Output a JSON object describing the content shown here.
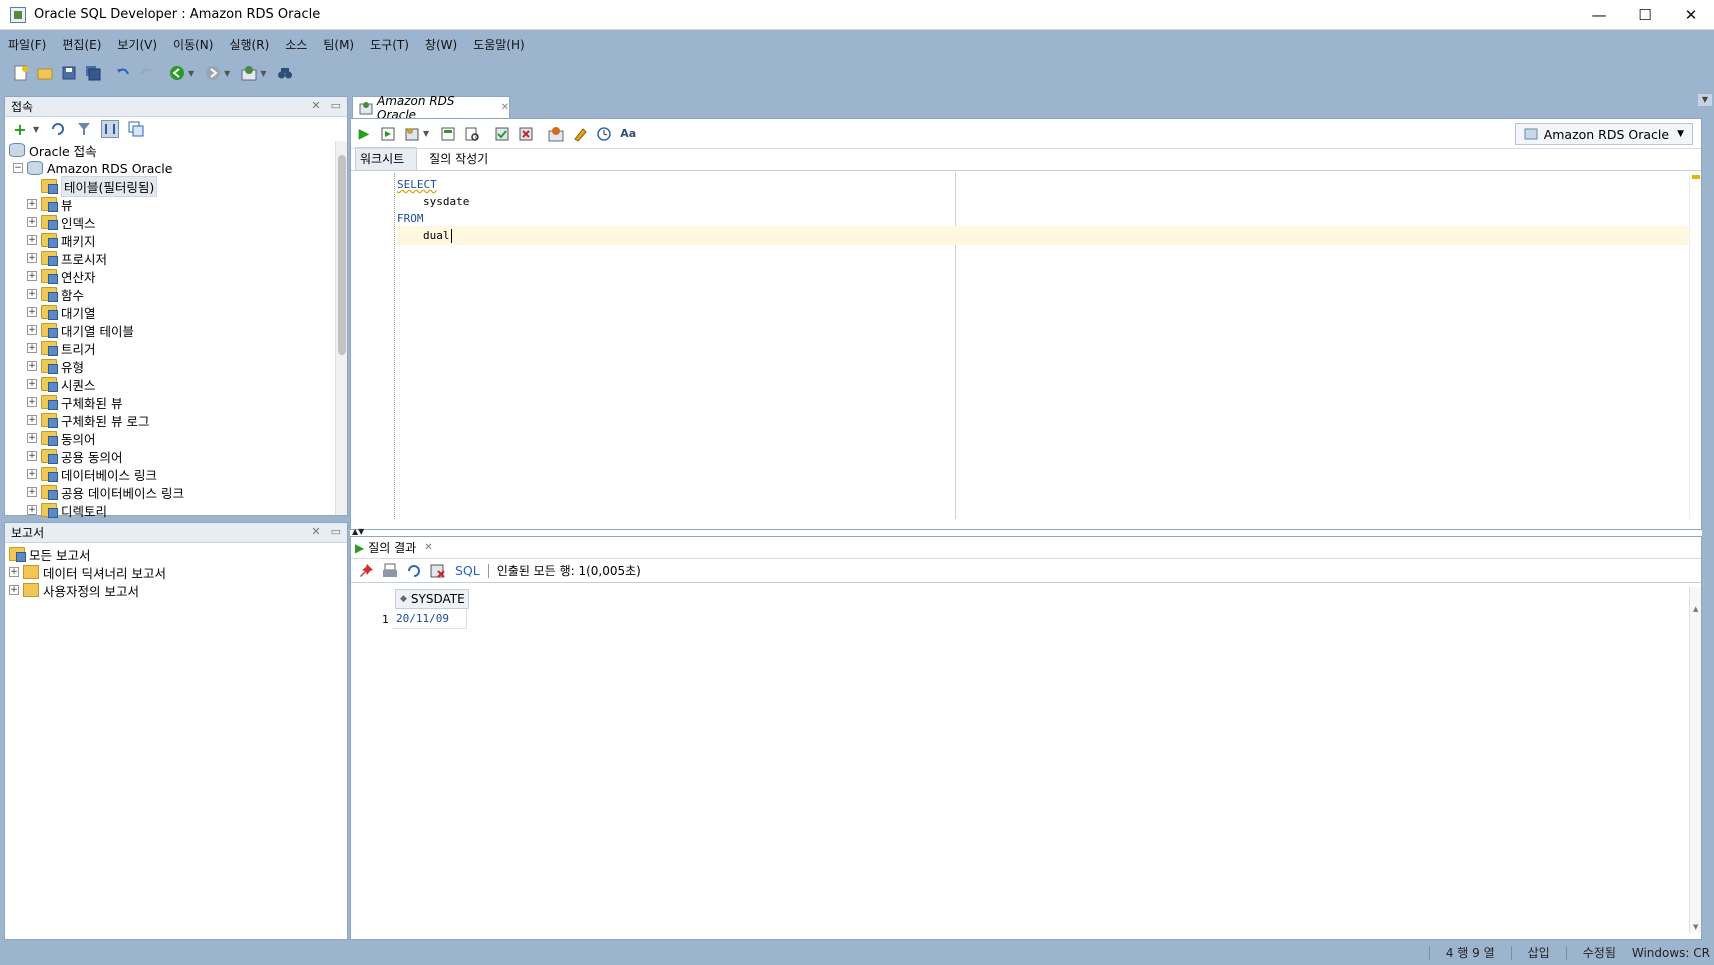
{
  "window": {
    "title": "Oracle SQL Developer : Amazon RDS Oracle",
    "minimize": "—",
    "maximize": "☐",
    "close": "✕"
  },
  "menu": [
    "파일(F)",
    "편집(E)",
    "보기(V)",
    "이동(N)",
    "실행(R)",
    "소스",
    "팀(M)",
    "도구(T)",
    "창(W)",
    "도움말(H)"
  ],
  "connections_panel": {
    "title": "접속",
    "tree": {
      "root": "Oracle 접속",
      "connection": "Amazon RDS Oracle",
      "items": [
        {
          "label": "테이블(필터링됨)",
          "expandable": false,
          "selected": true
        },
        {
          "label": "뷰",
          "expandable": true
        },
        {
          "label": "인덱스",
          "expandable": true
        },
        {
          "label": "패키지",
          "expandable": true
        },
        {
          "label": "프로시저",
          "expandable": true
        },
        {
          "label": "연산자",
          "expandable": true
        },
        {
          "label": "함수",
          "expandable": true
        },
        {
          "label": "대기열",
          "expandable": true
        },
        {
          "label": "대기열 테이블",
          "expandable": true
        },
        {
          "label": "트리거",
          "expandable": true
        },
        {
          "label": "유형",
          "expandable": true
        },
        {
          "label": "시퀀스",
          "expandable": true
        },
        {
          "label": "구체화된 뷰",
          "expandable": true
        },
        {
          "label": "구체화된 뷰 로그",
          "expandable": true
        },
        {
          "label": "동의어",
          "expandable": true
        },
        {
          "label": "공용 동의어",
          "expandable": true
        },
        {
          "label": "데이터베이스 링크",
          "expandable": true
        },
        {
          "label": "공용 데이터베이스 링크",
          "expandable": true
        },
        {
          "label": "디렉토리",
          "expandable": true
        }
      ]
    }
  },
  "reports_panel": {
    "title": "보고서",
    "root": "모든 보고서",
    "items": [
      "데이터 딕셔너리 보고서",
      "사용자정의 보고서"
    ]
  },
  "editor": {
    "tab_label": "Amazon RDS Oracle",
    "connection_selector": "Amazon RDS Oracle",
    "subtabs": [
      "워크시트",
      "질의 작성기"
    ],
    "code_lines": [
      "SELECT",
      "sysdate",
      "FROM",
      "dual"
    ],
    "keywords": [
      "SELECT",
      "FROM"
    ]
  },
  "results": {
    "tab_label": "질의 결과",
    "sql_link": "SQL",
    "fetch_status": "인출된 모든 행: 1(0,005초)",
    "columns": [
      "SYSDATE"
    ],
    "rows": [
      [
        "1",
        "20/11/09"
      ]
    ]
  },
  "status_bar": {
    "position": "4 행 9 열",
    "insert_mode": "삽입",
    "modified": "수정됨",
    "line_ending": "Windows: CR"
  },
  "colors": {
    "chrome_background": "#9db4cf",
    "keyword": "#1d4b9a",
    "current_line": "#fff7e0",
    "run_green": "#21a021"
  }
}
